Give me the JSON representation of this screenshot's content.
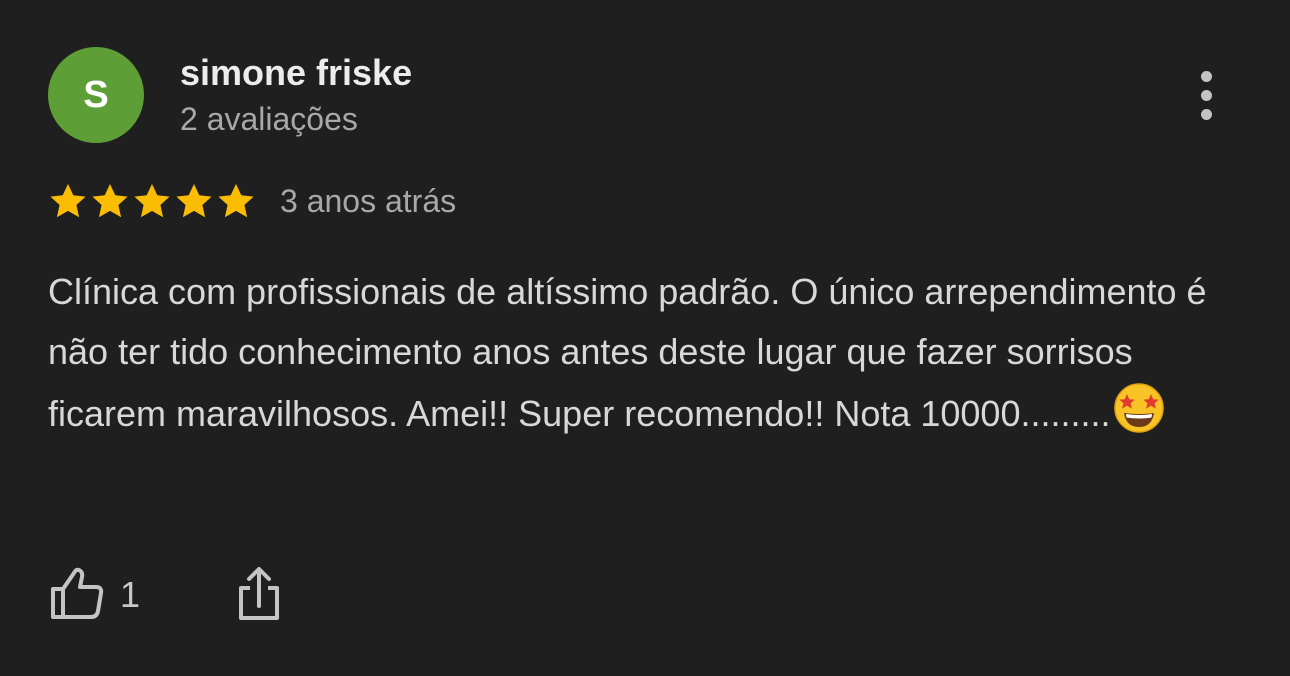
{
  "review": {
    "author": {
      "initial": "S",
      "name": "simone friske",
      "review_count": "2 avaliações",
      "avatar_color": "#5e9e36"
    },
    "rating": 5,
    "rating_max": 5,
    "star_color": "#fbbc04",
    "time_ago": "3 anos atrás",
    "text": "Clínica com profissionais de altíssimo padrão. O único arrependimento é não ter tido conhecimento anos antes deste lugar que fazer sorrisos ficarem maravilhosos. Amei!! Super recomendo!! Nota 10000.........",
    "emoji": "star-struck-emoji",
    "likes": "1",
    "icons": {
      "more": "more-vertical-icon",
      "like": "thumbs-up-icon",
      "share": "share-icon"
    }
  },
  "colors": {
    "background": "#1f1f1f",
    "primary_text": "#ececec",
    "secondary_text": "#a8a8a8",
    "icon": "#c4c4c4"
  }
}
